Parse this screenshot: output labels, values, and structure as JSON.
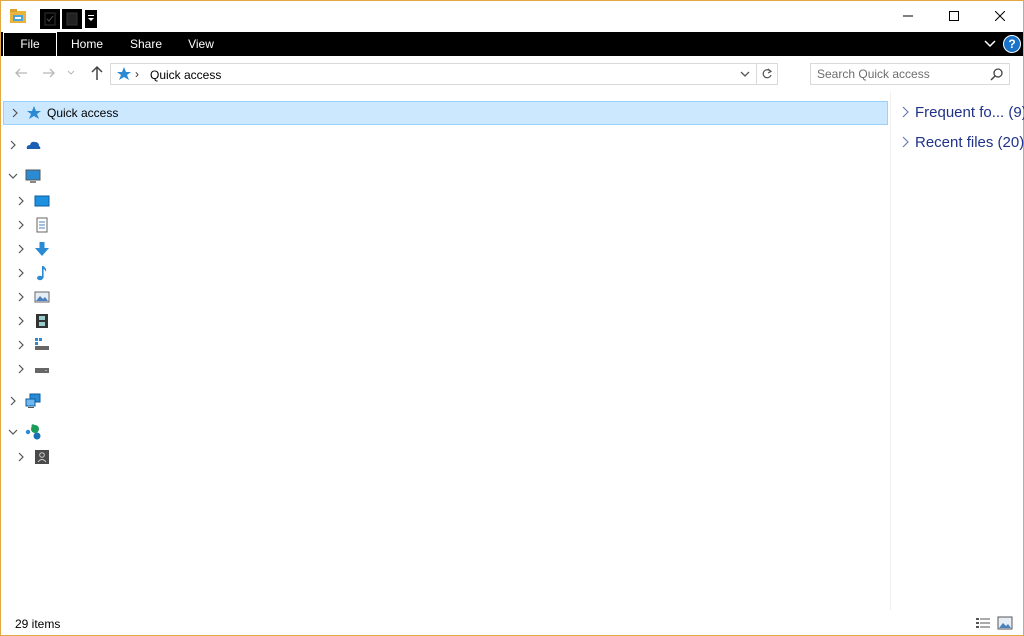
{
  "titlebar": {
    "minimize": "minimize",
    "maximize": "maximize",
    "close": "close"
  },
  "ribbon": {
    "tabs": [
      {
        "label": "File"
      },
      {
        "label": "Home"
      },
      {
        "label": "Share"
      },
      {
        "label": "View"
      }
    ],
    "help_label": "?"
  },
  "nav": {
    "path_segment": "Quick access",
    "search_placeholder": "Search Quick access"
  },
  "tree": {
    "items": [
      {
        "label": "Quick access",
        "icon": "star-icon",
        "selected": true,
        "expanded": false
      },
      {
        "label": "",
        "icon": "onedrive-icon",
        "expanded": false
      },
      {
        "label": "",
        "icon": "this-pc-icon",
        "expanded": true
      },
      {
        "label": "",
        "icon": "desktop-icon",
        "expanded": false
      },
      {
        "label": "",
        "icon": "documents-icon",
        "expanded": false
      },
      {
        "label": "",
        "icon": "downloads-icon",
        "expanded": false
      },
      {
        "label": "",
        "icon": "music-icon",
        "expanded": false
      },
      {
        "label": "",
        "icon": "pictures-icon",
        "expanded": false
      },
      {
        "label": "",
        "icon": "videos-icon",
        "expanded": false
      },
      {
        "label": "",
        "icon": "windows-drive-icon",
        "expanded": false
      },
      {
        "label": "",
        "icon": "drive-icon",
        "expanded": false
      },
      {
        "label": "",
        "icon": "network-icon",
        "expanded": false
      },
      {
        "label": "",
        "icon": "homegroup-icon",
        "expanded": true
      },
      {
        "label": "",
        "icon": "user-icon",
        "expanded": false
      }
    ]
  },
  "rightpane": {
    "groups": [
      {
        "label": "Frequent fo... (9)"
      },
      {
        "label": "Recent files (20)"
      }
    ]
  },
  "status": {
    "count": "29 items"
  },
  "colors": {
    "accent": "#0078d7",
    "selection_bg": "#cce8ff",
    "selection_border": "#99d1ff",
    "group_text": "#1e3287",
    "window_border": "#e3a846"
  }
}
